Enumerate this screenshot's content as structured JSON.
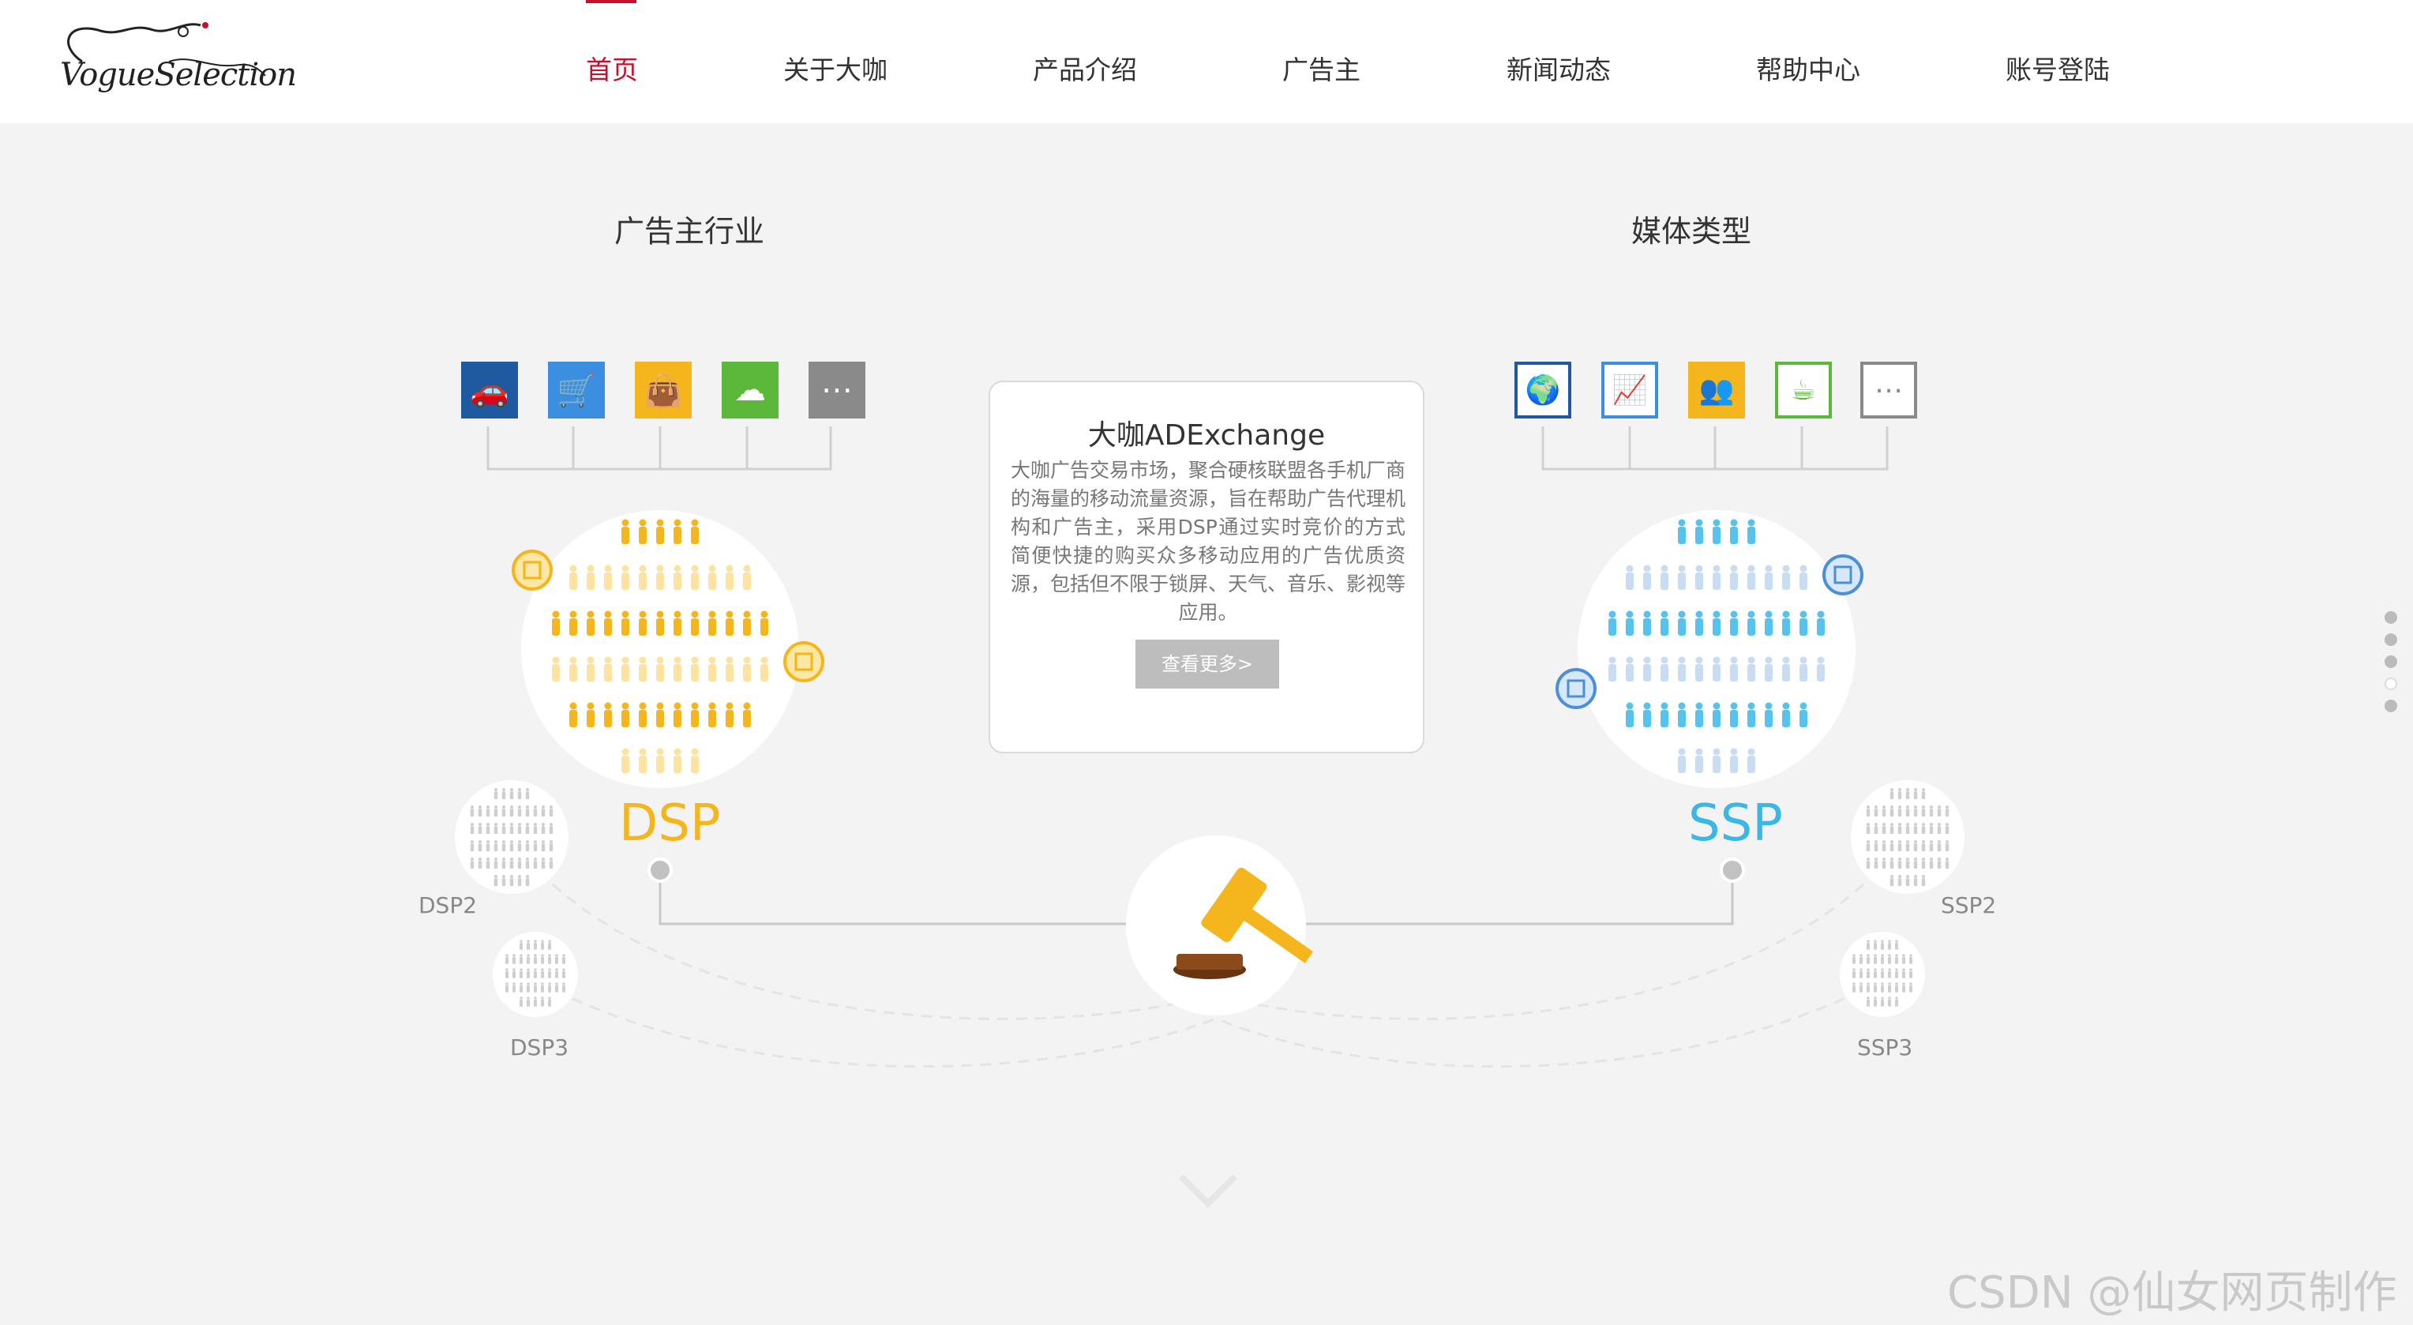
{
  "header": {
    "logo_text": "VogueSelection",
    "nav": [
      {
        "label": "首页",
        "active": true
      },
      {
        "label": "关于大咖",
        "active": false
      },
      {
        "label": "产品介绍",
        "active": false
      },
      {
        "label": "广告主",
        "active": false
      },
      {
        "label": "新闻动态",
        "active": false
      },
      {
        "label": "帮助中心",
        "active": false
      },
      {
        "label": "账号登陆",
        "active": false
      }
    ]
  },
  "left": {
    "title": "广告主行业",
    "icons": [
      {
        "icon": "car-icon",
        "color": "#1f5aa0"
      },
      {
        "icon": "cart-icon",
        "color": "#3b8ee0"
      },
      {
        "icon": "bag-icon",
        "color": "#f5b51c"
      },
      {
        "icon": "cloud-icon",
        "color": "#5bb83a"
      },
      {
        "icon": "more-icon",
        "color": "#8a8a8a"
      }
    ],
    "primary_label": "DSP",
    "primary_color": "#f5b51c",
    "secondary": [
      "DSP2",
      "DSP3"
    ]
  },
  "right": {
    "title": "媒体类型",
    "icons": [
      {
        "icon": "globe-icon",
        "color": "#1f5aa0"
      },
      {
        "icon": "chart-icon",
        "color": "#3b8ee0"
      },
      {
        "icon": "people-icon",
        "color": "#f5b51c"
      },
      {
        "icon": "coffee-icon",
        "color": "#5bb83a"
      },
      {
        "icon": "more-icon",
        "color": "#8a8a8a"
      }
    ],
    "primary_label": "SSP",
    "primary_color": "#3bb7e6",
    "secondary": [
      "SSP2",
      "SSP3"
    ]
  },
  "card": {
    "title": "大咖ADExchange",
    "text": "大咖广告交易市场，聚合硬核联盟各手机厂商的海量的移动流量资源，旨在帮助广告代理机构和广告主，采用DSP通过实时竞价的方式简便快捷的购买众多移动应用的广告优质资源，包括但不限于锁屏、天气、音乐、影视等应用。",
    "button": "查看更多>"
  },
  "watermark": "CSDN @仙女网页制作"
}
